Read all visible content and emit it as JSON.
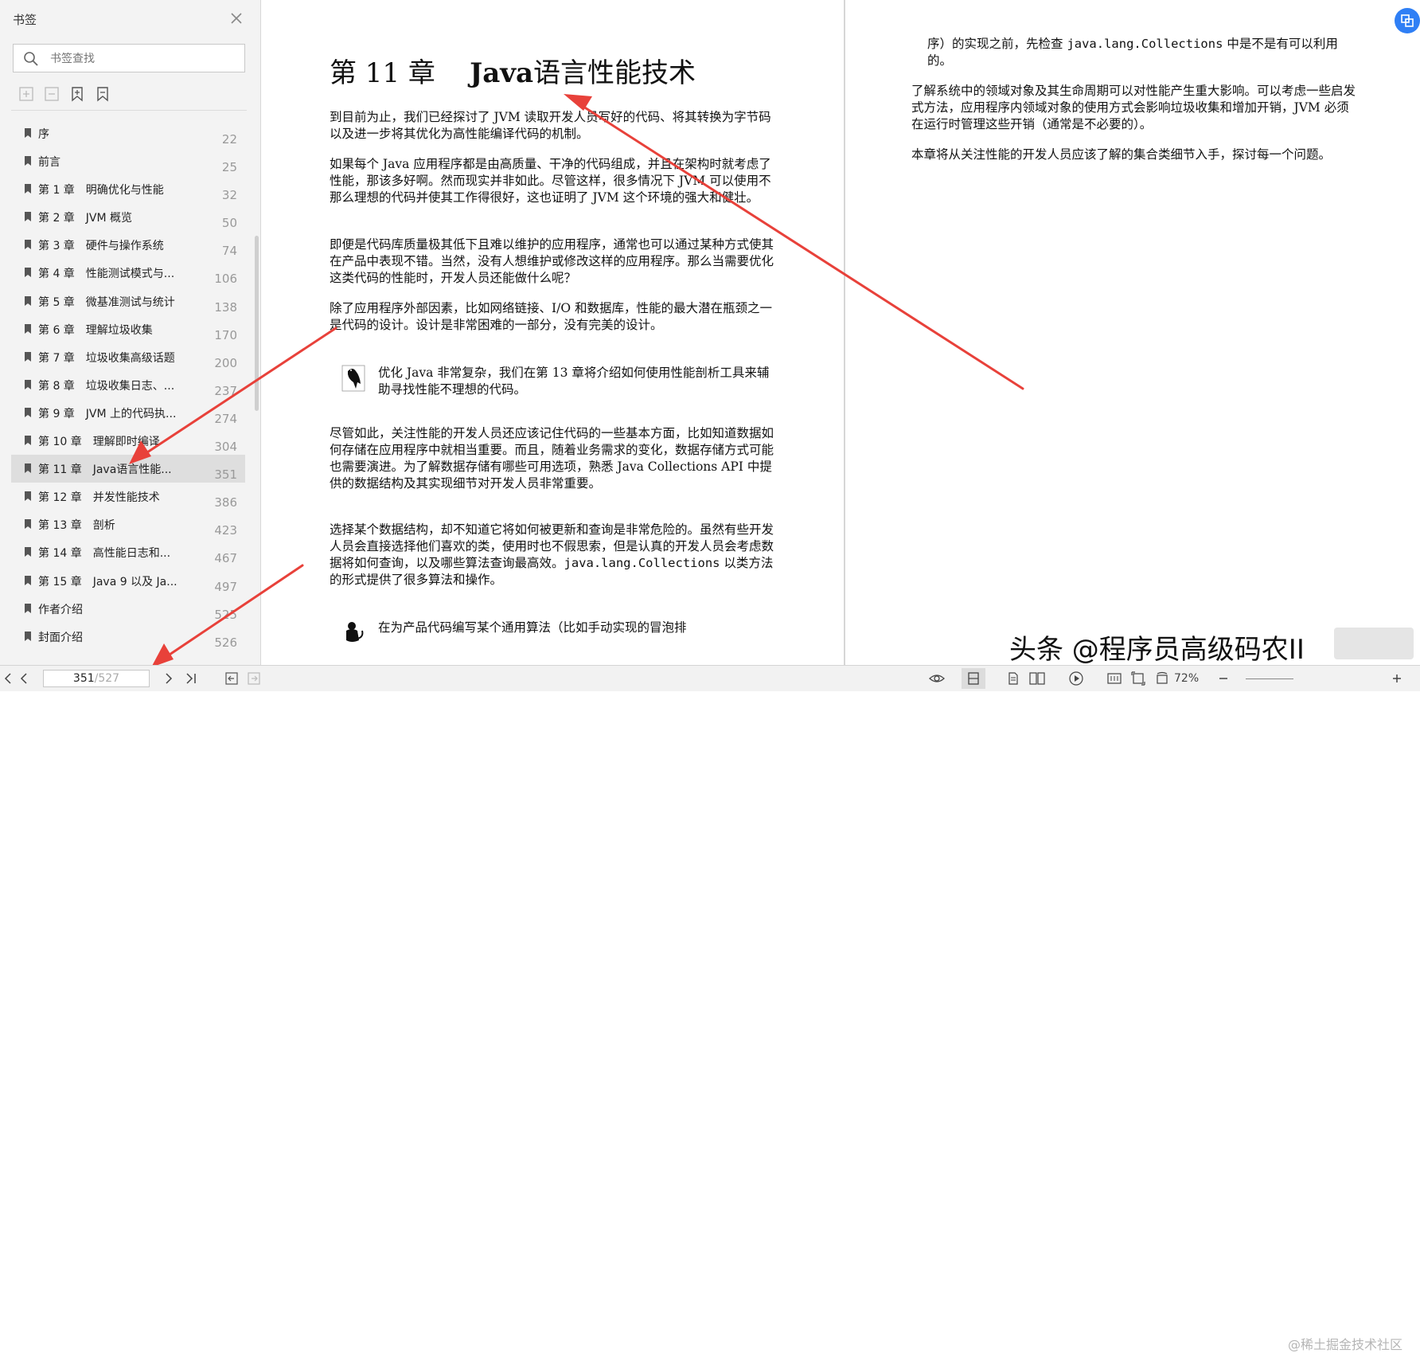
{
  "sidebar": {
    "title": "书签",
    "search_placeholder": "书签查找",
    "bookmarks": [
      {
        "label": "序",
        "page": "22"
      },
      {
        "label": "前言",
        "page": "25"
      },
      {
        "label": "第 1 章　明确优化与性能",
        "page": "32"
      },
      {
        "label": "第 2 章　JVM 概览",
        "page": "50"
      },
      {
        "label": "第 3 章　硬件与操作系统",
        "page": "74"
      },
      {
        "label": "第 4 章　性能测试模式与...",
        "page": "106"
      },
      {
        "label": "第 5 章　微基准测试与统计",
        "page": "138"
      },
      {
        "label": "第 6 章　理解垃圾收集",
        "page": "170"
      },
      {
        "label": "第 7 章　垃圾收集高级话题",
        "page": "200"
      },
      {
        "label": "第 8 章　垃圾收集日志、...",
        "page": "237"
      },
      {
        "label": "第 9 章　JVM 上的代码执...",
        "page": "274"
      },
      {
        "label": "第 10 章　理解即时编译",
        "page": "304"
      },
      {
        "label": "第 11 章　Java语言性能...",
        "page": "351"
      },
      {
        "label": "第 12 章　并发性能技术",
        "page": "386"
      },
      {
        "label": "第 13 章　剖析",
        "page": "423"
      },
      {
        "label": "第 14 章　高性能日志和...",
        "page": "467"
      },
      {
        "label": "第 15 章　Java 9 以及 Ja...",
        "page": "497"
      },
      {
        "label": "作者介绍",
        "page": "525"
      },
      {
        "label": "封面介绍",
        "page": "526"
      }
    ]
  },
  "left_page": {
    "chapter_num": "第 11 章",
    "chapter_title_bold": "Java",
    "chapter_title_rest": "语言性能技术",
    "paragraphs": [
      "到目前为止，我们已经探讨了 JVM 读取开发人员写好的代码、将其转换为字节码以及进一步将其优化为高性能编译代码的机制。",
      "如果每个 Java 应用程序都是由高质量、干净的代码组成，并且在架构时就考虑了性能，那该多好啊。然而现实并非如此。尽管这样，很多情况下 JVM 可以使用不那么理想的代码并使其工作得很好，这也证明了 JVM 这个环境的强大和健壮。",
      "即便是代码库质量极其低下且难以维护的应用程序，通常也可以通过某种方式使其在产品中表现不错。当然，没有人想维护或修改这样的应用程序。那么当需要优化这类代码的性能时，开发人员还能做什么呢？",
      "除了应用程序外部因素，比如网络链接、I/O 和数据库，性能的最大潜在瓶颈之一是代码的设计。设计是非常困难的一部分，没有完美的设计。",
      "尽管如此，关注性能的开发人员还应该记住代码的一些基本方面，比如知道数据如何存储在应用程序中就相当重要。而且，随着业务需求的变化，数据存储方式可能也需要演进。为了解数据存储有哪些可用选项，熟悉 Java Collections API 中提供的数据结构及其实现细节对开发人员非常重要。"
    ],
    "note1": "优化 Java 非常复杂，我们在第 13 章将介绍如何使用性能剖析工具来辅助寻找性能不理想的代码。",
    "para6_a": "选择某个数据结构，却不知道它将如何被更新和查询是非常危险的。虽然有些开发人员会直接选择他们喜欢的类，使用时也不假思索，但是认真的开发人员会考虑数据将如何查询，以及哪些算法查询最高效。",
    "para6_code": "java.lang.Collections",
    "para6_b": " 以类方法的形式提供了很多算法和操作。",
    "note2": "在为产品代码编写某个通用算法（比如手动实现的冒泡排"
  },
  "right_page": {
    "cont_a": "序）的实现之前，先检查 ",
    "cont_code": "java.lang.Collections",
    "cont_b": " 中是不是有可以利用的。",
    "paragraphs": [
      "了解系统中的领域对象及其生命周期可以对性能产生重大影响。可以考虑一些启发式方法，应用程序内领域对象的使用方式会影响垃圾收集和增加开销，JVM 必须在运行时管理这些开销（通常是不必要的）。",
      "本章将从关注性能的开发人员应该了解的集合类细节入手，探讨每一个问题。"
    ]
  },
  "bottombar": {
    "current_page": "351",
    "total_pages": "/527",
    "zoom": "72%"
  },
  "watermark": "头条 @程序员高级码农II",
  "watermark2": "@稀土掘金技术社区",
  "colors": {
    "accent": "#2f7ff5",
    "arrow": "#e8413a",
    "sidebar_bg": "#f3f3f3"
  }
}
